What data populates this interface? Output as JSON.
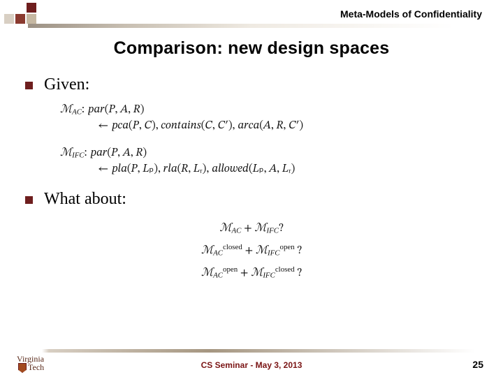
{
  "header": {
    "topic": "Meta-Models of Confidentiality",
    "title": "Comparison: new design spaces"
  },
  "bullets": {
    "given": "Given:",
    "what_about": "What about:"
  },
  "formulas": {
    "mac_head": "ℳ",
    "mac_sub": "AC",
    "par_sig": ": 𝑝𝑎𝑟(𝑃, 𝐴, 𝑅)",
    "arrow": "←",
    "mac_body": "𝑝𝑐𝑎(𝑃, 𝐶), 𝑐𝑜𝑛𝑡𝑎𝑖𝑛𝑠(𝐶, 𝐶′), 𝑎𝑟𝑐𝑎(𝐴, 𝑅, 𝐶′)",
    "mifc_sub": "IFC",
    "mifc_body": "𝑝𝑙𝑎(𝑃, 𝐿ₚ), 𝑟𝑙𝑎(𝑅, 𝐿ᵣ), 𝑎𝑙𝑙𝑜𝑤𝑒𝑑(𝐿ₚ, 𝐴, 𝐿ᵣ)",
    "plus": " + ",
    "qmark": "?",
    "sup_closed": "closed",
    "sup_open": "open"
  },
  "footer": {
    "logo_top": "Virginia",
    "logo_bottom": "Tech",
    "center": "CS Seminar - May 3, 2013",
    "page": "25"
  }
}
